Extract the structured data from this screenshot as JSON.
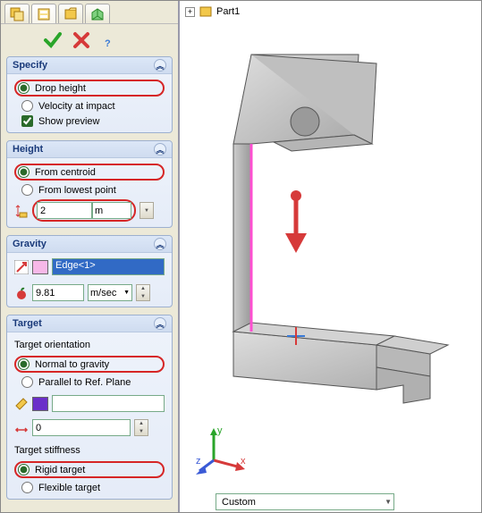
{
  "tree": {
    "root_label": "Part1"
  },
  "groups": {
    "specify": {
      "title": "Specify",
      "drop_height": "Drop height",
      "velocity": "Velocity at impact",
      "show_preview": "Show preview"
    },
    "height": {
      "title": "Height",
      "from_centroid": "From centroid",
      "from_lowest": "From lowest point",
      "value": "2",
      "unit": "m"
    },
    "gravity": {
      "title": "Gravity",
      "selection": "Edge<1>",
      "value": "9.81",
      "unit": "m/sec"
    },
    "target": {
      "title": "Target",
      "orientation_head": "Target orientation",
      "normal": "Normal to gravity",
      "parallel": "Parallel to Ref. Plane",
      "friction_value": "0",
      "stiffness_head": "Target stiffness",
      "rigid": "Rigid target",
      "flexible": "Flexible target"
    }
  },
  "viewport": {
    "dropdown": "Custom",
    "axes": {
      "x": "x",
      "y": "y",
      "z": "z"
    }
  },
  "colors": {
    "accent_blue": "#316ac5",
    "highlight_red": "#d62626",
    "purple": "#6a2fc9",
    "pink": "#f7b8e8"
  }
}
